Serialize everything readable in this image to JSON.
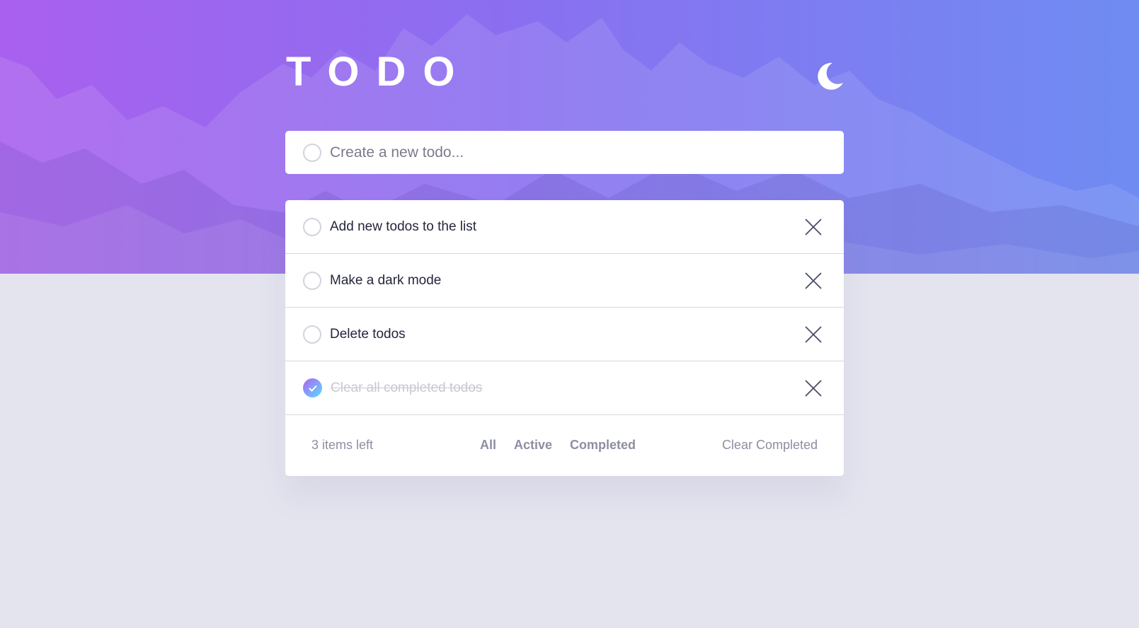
{
  "header": {
    "title": "TODO",
    "theme_icon": "moon-icon"
  },
  "new_todo": {
    "placeholder": "Create a new todo..."
  },
  "todos": [
    {
      "text": "Add new todos to the list",
      "completed": false
    },
    {
      "text": "Make a dark mode",
      "completed": false
    },
    {
      "text": "Delete todos",
      "completed": false
    },
    {
      "text": "Clear all completed todos",
      "completed": true
    }
  ],
  "footer": {
    "items_left": "3 items left",
    "filters": [
      "All",
      "Active",
      "Completed"
    ],
    "clear_label": "Clear Completed"
  },
  "colors": {
    "gradient_start": "#a960ee",
    "gradient_end": "#6f8cf2",
    "check_start": "#b261f2",
    "check_end": "#57ddff",
    "background": "#e4e4ef",
    "text": "#25273c",
    "muted": "#8d8ea2"
  }
}
